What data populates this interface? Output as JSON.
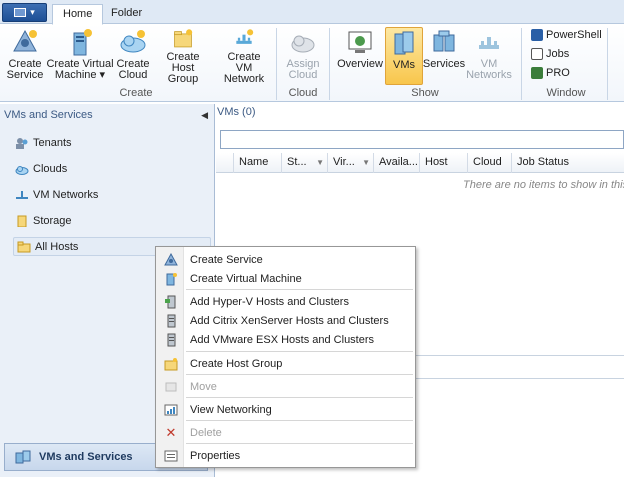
{
  "tabs": [
    "Home",
    "Folder"
  ],
  "ribbon": {
    "create": [
      "Create Service",
      "Create Virtual Machine",
      "Create Cloud",
      "Create Host Group",
      "Create VM Network"
    ],
    "create_vm_l1": "Create Virtual",
    "create_vm_l2": "Machine",
    "cloud": {
      "l1": "Assign",
      "l2": "Cloud"
    },
    "show": [
      "Overview",
      "VMs",
      "Services",
      "VM Networks"
    ],
    "window": [
      "PowerShell",
      "Jobs",
      "PRO"
    ],
    "groups": [
      "Create",
      "Cloud",
      "Show",
      "Window"
    ]
  },
  "left": {
    "header": "VMs and Services",
    "items": [
      "Tenants",
      "Clouds",
      "VM Networks",
      "Storage",
      "All Hosts"
    ],
    "workspace": "VMs and Services"
  },
  "main": {
    "header": "VMs (0)",
    "columns": [
      "Name",
      "St...",
      "Vir...",
      "Availa...",
      "Host",
      "Cloud",
      "Job Status"
    ],
    "empty_text": "There are no items to show in this vi"
  },
  "context_menu": [
    {
      "label": "Create Service",
      "icon": "create-service-icon",
      "disabled": false
    },
    {
      "label": "Create Virtual Machine",
      "icon": "create-vm-icon",
      "disabled": false
    },
    {
      "label": "Add Hyper-V Hosts and Clusters",
      "icon": "hyperv-host-icon",
      "disabled": false
    },
    {
      "label": "Add Citrix XenServer Hosts and Clusters",
      "icon": "xenserver-host-icon",
      "disabled": false
    },
    {
      "label": "Add VMware ESX Hosts and Clusters",
      "icon": "esx-host-icon",
      "disabled": false
    },
    {
      "label": "Create Host Group",
      "icon": "host-group-icon",
      "disabled": false
    },
    {
      "label": "Move",
      "icon": "move-icon",
      "disabled": true
    },
    {
      "label": "View Networking",
      "icon": "networking-icon",
      "disabled": false
    },
    {
      "label": "Delete",
      "icon": "delete-icon",
      "disabled": true
    },
    {
      "label": "Properties",
      "icon": "properties-icon",
      "disabled": false
    }
  ],
  "colors": {
    "accent": "#1d4f95",
    "selected": "#f8c64c",
    "pane": "#eaf0f8"
  }
}
